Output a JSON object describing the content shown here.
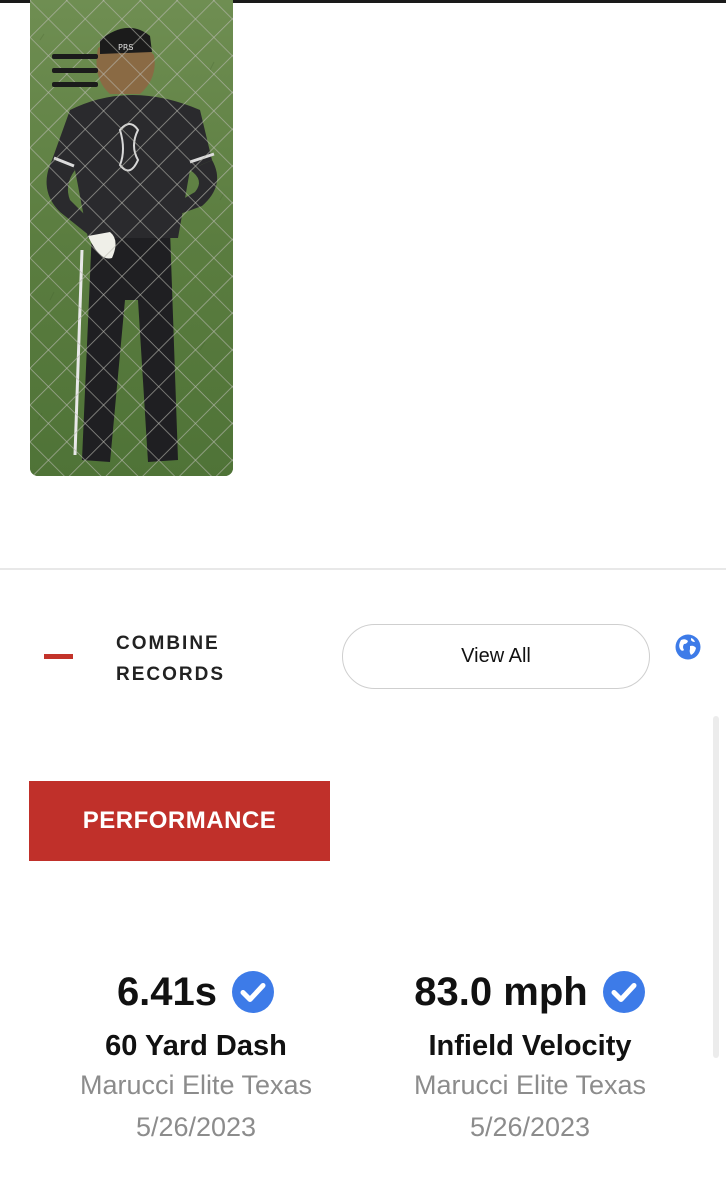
{
  "header": {
    "menu_icon": "hamburger-menu-icon"
  },
  "profile": {
    "photo_alt": "player-photo"
  },
  "combine": {
    "section_title_line1": "COMBINE",
    "section_title_line2": "RECORDS",
    "view_all_label": "View All",
    "globe_icon": "globe-icon",
    "accent_color": "#c0302a"
  },
  "tabs": {
    "active_label": "PERFORMANCE"
  },
  "stats": [
    {
      "value": "6.41s",
      "name": "60 Yard Dash",
      "team": "Marucci Elite Texas",
      "date": "5/26/2023",
      "verified_icon": "verified-check-icon"
    },
    {
      "value": "83.0 mph",
      "name": "Infield Velocity",
      "team": "Marucci Elite Texas",
      "date": "5/26/2023",
      "verified_icon": "verified-check-icon"
    }
  ],
  "colors": {
    "verified_blue": "#3d7be8",
    "muted_text": "#8c8c8c"
  }
}
